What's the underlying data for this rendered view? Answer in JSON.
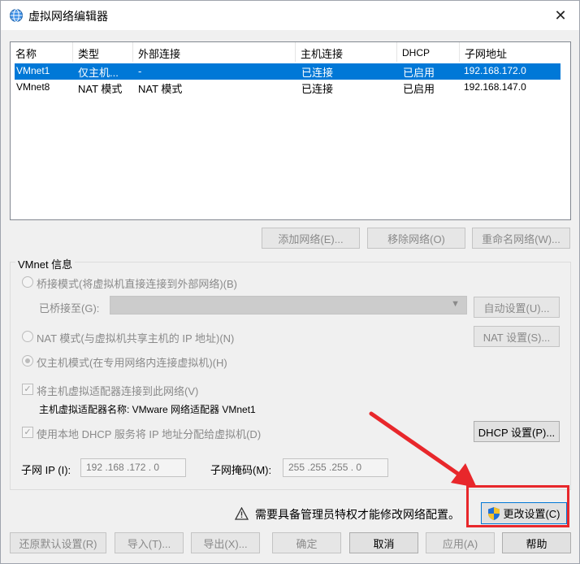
{
  "window": {
    "title": "虚拟网络编辑器",
    "close_icon": "close-icon"
  },
  "table": {
    "columns": [
      "名称",
      "类型",
      "外部连接",
      "主机连接",
      "DHCP",
      "子网地址"
    ],
    "rows": [
      {
        "name": "VMnet1",
        "type": "仅主机...",
        "external": "-",
        "host": "已连接",
        "dhcp": "已启用",
        "subnet": "192.168.172.0",
        "selected": true
      },
      {
        "name": "VMnet8",
        "type": "NAT 模式",
        "external": "NAT 模式",
        "host": "已连接",
        "dhcp": "已启用",
        "subnet": "192.168.147.0",
        "selected": false
      }
    ]
  },
  "list_buttons": {
    "add": "添加网络(E)...",
    "remove": "移除网络(O)",
    "rename": "重命名网络(W)..."
  },
  "vmnet_info": {
    "group_label": "VMnet 信息",
    "bridge_radio": "桥接模式(将虚拟机直接连接到外部网络)(B)",
    "bridged_to_label": "已桥接至(G):",
    "auto_settings": "自动设置(U)...",
    "nat_radio": "NAT 模式(与虚拟机共享主机的 IP 地址)(N)",
    "nat_settings": "NAT 设置(S)...",
    "host_only_radio": "仅主机模式(在专用网络内连接虚拟机)(H)",
    "connect_adapter_check": "将主机虚拟适配器连接到此网络(V)",
    "adapter_name": "主机虚拟适配器名称: VMware 网络适配器 VMnet1",
    "dhcp_check": "使用本地 DHCP 服务将 IP 地址分配给虚拟机(D)",
    "dhcp_settings": "DHCP 设置(P)...",
    "subnet_ip_label": "子网 IP (I):",
    "subnet_ip_value": "192 .168 .172 .  0",
    "subnet_mask_label": "子网掩码(M):",
    "subnet_mask_value": "255 .255 .255 .  0"
  },
  "admin_notice": "需要具备管理员特权才能修改网络配置。",
  "change_settings": "更改设置(C)",
  "bottom_buttons": {
    "restore": "还原默认设置(R)",
    "import": "导入(T)...",
    "export": "导出(X)...",
    "ok": "确定",
    "cancel": "取消",
    "apply": "应用(A)",
    "help": "帮助"
  },
  "colors": {
    "selection": "#0078d7",
    "highlight_red": "#e8272b"
  }
}
